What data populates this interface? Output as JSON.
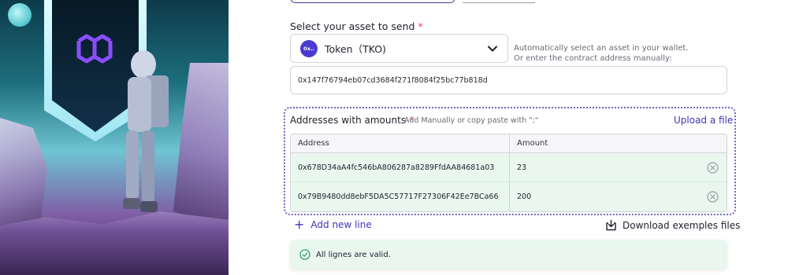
{
  "form": {
    "asset_label": "Select your asset to send",
    "required_mark": "*",
    "token": {
      "badge": "0x..",
      "name": "Token（TKO)"
    },
    "hint_line1": "Automatically select an asset in your wallet.",
    "hint_line2": "Or enter the contract address manually:",
    "contract_address": "0x147f76794eb07cd3684f271f8084f25bc77b818d"
  },
  "recipients": {
    "title": "Addresses with amounts",
    "required_mark": "*",
    "subtitle": "Add Manually or copy paste with \";\"",
    "upload_label": "Upload a file",
    "columns": [
      "Address",
      "Amount"
    ],
    "rows": [
      {
        "address": "0x678D34aA4fc546bA806287a8289FfdAA84681a03",
        "amount": "23"
      },
      {
        "address": "0x79B9480dd8ebF5DA5C57717F27306F42Ee7BCa66",
        "amount": "200"
      }
    ],
    "add_line_label": "Add new line",
    "download_label": "Download exemples files"
  },
  "status": {
    "message": "All lignes are valid."
  },
  "colors": {
    "accent": "#3d35b5",
    "valid_bg": "#e9f7ef",
    "required": "#e2445c",
    "token": "#4a3bd0"
  }
}
